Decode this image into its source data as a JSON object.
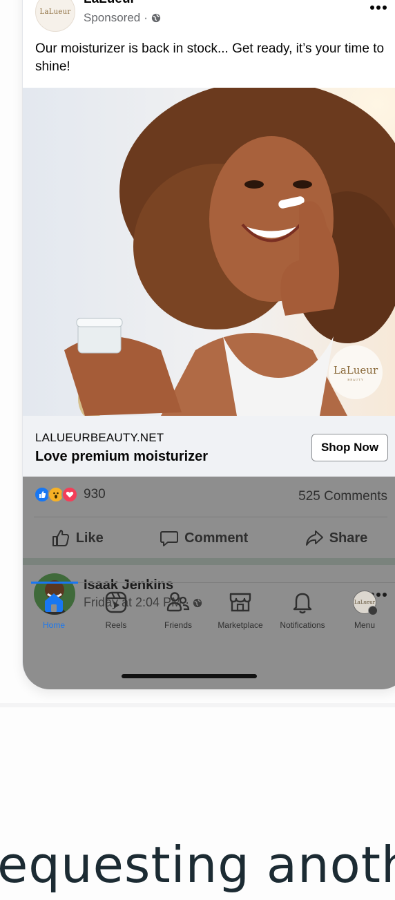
{
  "post": {
    "page_name": "LaLueur",
    "avatar_text": "LaLueur",
    "sponsored_label": "Sponsored",
    "separator": "·",
    "caption": "Our moisturizer is back in stock... Get ready, it’s your time to shine!",
    "image_logo_text": "LaLueur",
    "image_logo_sub": "BEAUTY"
  },
  "link": {
    "domain": "LALUEURBEAUTY.NET",
    "title": "Love premium moisturizer",
    "cta": "Shop Now"
  },
  "engagement": {
    "reaction_count": "930",
    "comments": "525 Comments",
    "like": "Like",
    "comment": "Comment",
    "share": "Share"
  },
  "next_post": {
    "author": "Isaak Jenkins",
    "time": "Friday at 2:04 PM",
    "separator": "·"
  },
  "nav": {
    "items": [
      {
        "label": "Home",
        "icon": "home-icon",
        "active": true
      },
      {
        "label": "Reels",
        "icon": "reels-icon",
        "active": false
      },
      {
        "label": "Friends",
        "icon": "friends-icon",
        "active": false
      },
      {
        "label": "Marketplace",
        "icon": "marketplace-icon",
        "active": false
      },
      {
        "label": "Notifications",
        "icon": "bell-icon",
        "active": false
      },
      {
        "label": "Menu",
        "icon": "menu-avatar",
        "active": false
      }
    ],
    "menu_avatar_text": "LaLueur"
  },
  "colors": {
    "accent": "#1877f2",
    "like_reaction": "#1877f2",
    "wow_reaction": "#f7b125",
    "love_reaction": "#f33e58"
  },
  "footer_text": "equesting anoth"
}
